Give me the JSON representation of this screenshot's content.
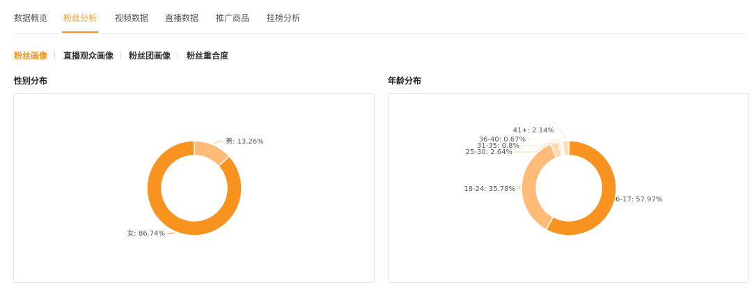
{
  "tabs": [
    "数据概览",
    "粉丝分析",
    "视频数据",
    "直播数据",
    "推广商品",
    "挂榜分析"
  ],
  "subtabs": [
    "粉丝画像",
    "直播观众画像",
    "粉丝团画像",
    "粉丝重合度"
  ],
  "colors": {
    "accent": "#f7931e",
    "light": "#ffbb77"
  },
  "chart_data": [
    {
      "type": "pie",
      "title": "性别分布",
      "slices": [
        {
          "label": "男",
          "value": 13.26,
          "text": "男: 13.26%",
          "color": "#ffbb77"
        },
        {
          "label": "女",
          "value": 86.74,
          "text": "女: 86.74%",
          "color": "#f7931e"
        }
      ]
    },
    {
      "type": "pie",
      "title": "年龄分布",
      "slices": [
        {
          "label": "6-17",
          "value": 57.97,
          "text": "6-17: 57.97%",
          "color": "#f7931e"
        },
        {
          "label": "18-24",
          "value": 35.78,
          "text": "18-24: 35.78%",
          "color": "#ffbb77"
        },
        {
          "label": "25-30",
          "value": 2.64,
          "text": "25-30: 2.64%",
          "color": "#ffd9ae"
        },
        {
          "label": "31-35",
          "value": 0.8,
          "text": "31-35: 0.8%",
          "color": "#ffe6c9"
        },
        {
          "label": "36-40",
          "value": 0.67,
          "text": "36-40: 0.67%",
          "color": "#fff0de"
        },
        {
          "label": "41+",
          "value": 2.14,
          "text": "41+: 2.14%",
          "color": "#ffe0bb"
        }
      ]
    }
  ]
}
